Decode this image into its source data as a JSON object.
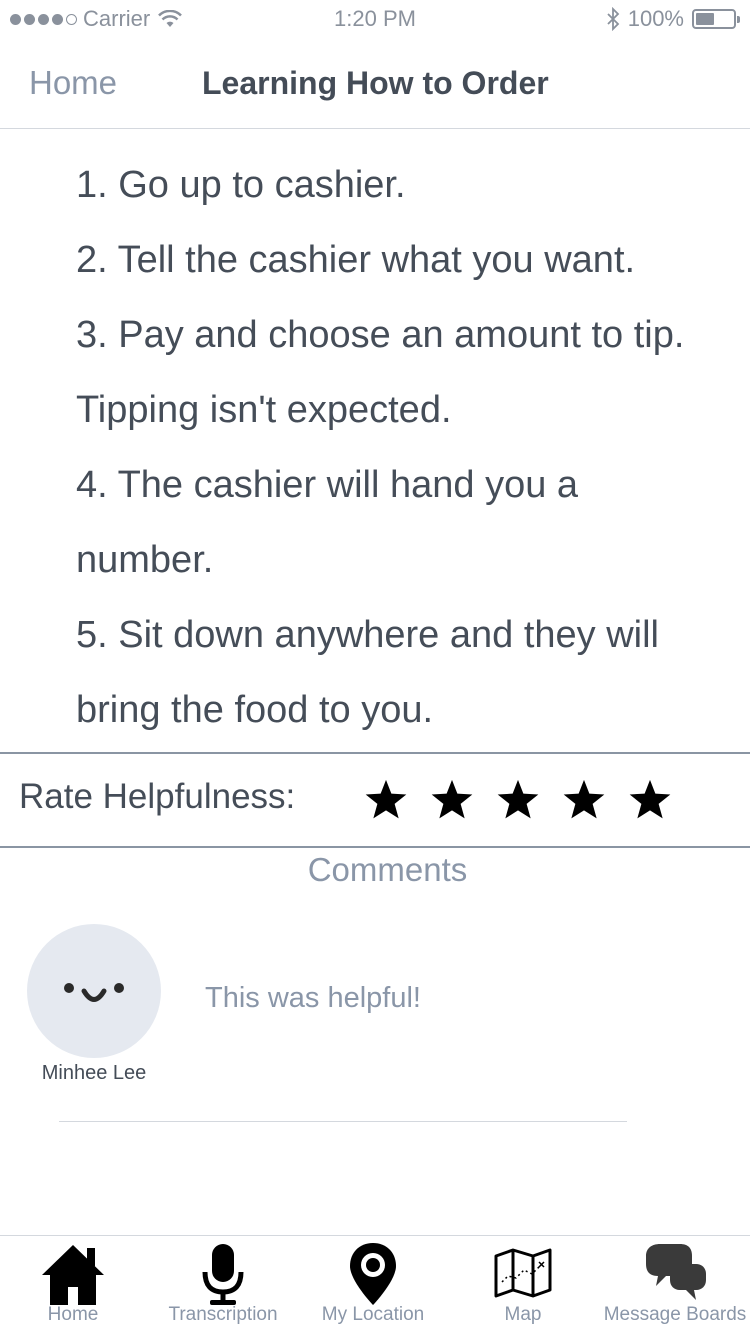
{
  "status_bar": {
    "carrier": "Carrier",
    "time": "1:20 PM",
    "battery": "100%",
    "battery_level": 0.5
  },
  "nav": {
    "back_label": "Home",
    "title": "Learning How to Order"
  },
  "steps": [
    "1. Go up to cashier.",
    "2. Tell the cashier what you want.",
    "3. Pay and choose an amount to tip. Tipping isn't expected.",
    "4. The cashier will hand you a number.",
    "5. Sit down anywhere and they will bring the food to you."
  ],
  "rating": {
    "label": "Rate Helpfulness:",
    "stars_filled": 5,
    "stars_total": 5
  },
  "comments": {
    "heading": "Comments",
    "items": [
      {
        "author": "Minhee Lee",
        "text": "This was helpful!"
      }
    ]
  },
  "tab_bar": {
    "items": [
      {
        "label": "Home",
        "icon": "home-icon"
      },
      {
        "label": "Transcription",
        "icon": "microphone-icon"
      },
      {
        "label": "My Location",
        "icon": "location-pin-icon"
      },
      {
        "label": "Map",
        "icon": "map-icon"
      },
      {
        "label": "Message Boards",
        "icon": "chat-bubbles-icon"
      }
    ]
  },
  "colors": {
    "muted_text": "#8a96a8",
    "body_text": "#454d58",
    "avatar_bg": "#e5e9f0",
    "star": "#000000"
  }
}
